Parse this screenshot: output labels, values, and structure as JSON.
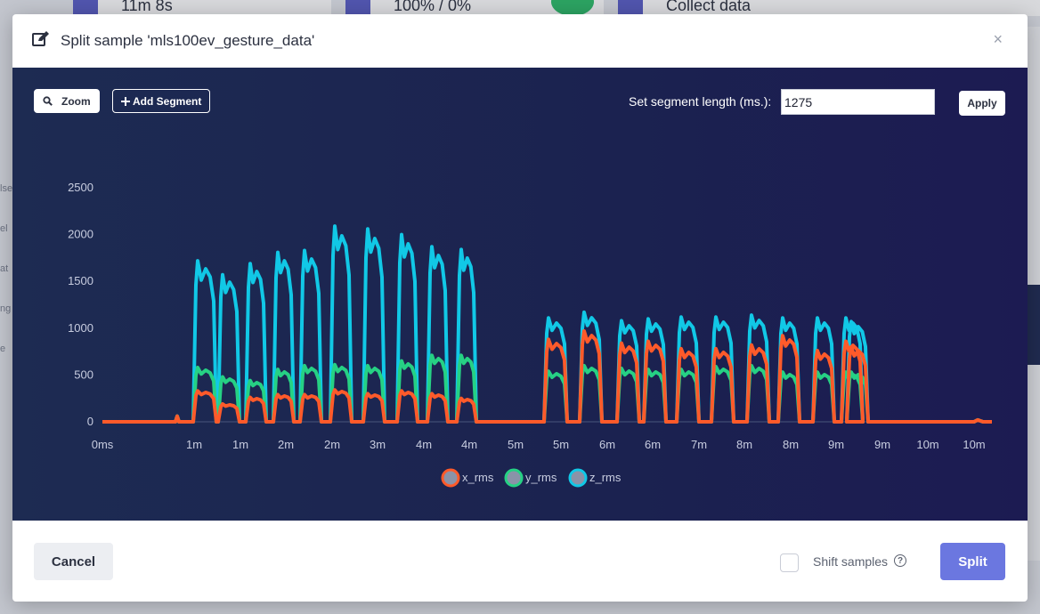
{
  "background": {
    "stat1": "11m 8s",
    "stat2": "100% / 0%",
    "stat3": "Collect data",
    "side_labels": [
      "lse",
      "el",
      "at",
      "ng",
      "e"
    ]
  },
  "modal": {
    "title": "Split sample 'mls100ev_gesture_data'",
    "close_label": "×"
  },
  "toolbar": {
    "zoom_label": "Zoom",
    "add_segment_label": "Add Segment",
    "segment_length_label": "Set segment length (ms.):",
    "segment_length_value": "1275",
    "apply_label": "Apply"
  },
  "footer": {
    "cancel_label": "Cancel",
    "shift_samples_label": "Shift samples",
    "shift_samples_checked": false,
    "split_label": "Split"
  },
  "colors": {
    "x_rms": "#ff5a2a",
    "y_rms": "#26d184",
    "z_rms": "#11c8e6",
    "primary": "#6b77e0"
  },
  "chart_data": {
    "type": "line",
    "y_ticks": [
      0,
      500,
      1000,
      1500,
      2000,
      2500
    ],
    "ylim": [
      0,
      2500
    ],
    "x_tick_labels": [
      "0ms",
      "1m",
      "1m",
      "2m",
      "2m",
      "3m",
      "4m",
      "4m",
      "5m",
      "5m",
      "6m",
      "6m",
      "7m",
      "8m",
      "8m",
      "9m",
      "9m",
      "10m",
      "10m"
    ],
    "legend": [
      "x_rms",
      "y_rms",
      "z_rms"
    ],
    "bursts": [
      {
        "z": 1720,
        "y": 580,
        "x": 330
      },
      {
        "z": 1570,
        "y": 480,
        "x": 190
      },
      {
        "z": 1690,
        "y": 440,
        "x": 260
      },
      {
        "z": 1810,
        "y": 560,
        "x": 290
      },
      {
        "z": 1830,
        "y": 600,
        "x": 290
      },
      {
        "z": 2090,
        "y": 610,
        "x": 340
      },
      {
        "z": 2060,
        "y": 600,
        "x": 300
      },
      {
        "z": 2000,
        "y": 650,
        "x": 330
      },
      {
        "z": 1870,
        "y": 710,
        "x": 300
      },
      {
        "z": 1840,
        "y": 710,
        "x": 250
      },
      {
        "z": 1110,
        "y": 540,
        "x": 880
      },
      {
        "z": 1170,
        "y": 600,
        "x": 970
      },
      {
        "z": 1080,
        "y": 570,
        "x": 840
      },
      {
        "z": 1100,
        "y": 560,
        "x": 860
      },
      {
        "z": 1120,
        "y": 560,
        "x": 780
      },
      {
        "z": 1120,
        "y": 590,
        "x": 780
      },
      {
        "z": 1140,
        "y": 600,
        "x": 820
      },
      {
        "z": 1110,
        "y": 530,
        "x": 920
      },
      {
        "z": 1110,
        "y": 530,
        "x": 760
      },
      {
        "z": 1110,
        "y": 530,
        "x": 860
      },
      {
        "z": 1070,
        "y": 530,
        "x": 800
      }
    ]
  }
}
